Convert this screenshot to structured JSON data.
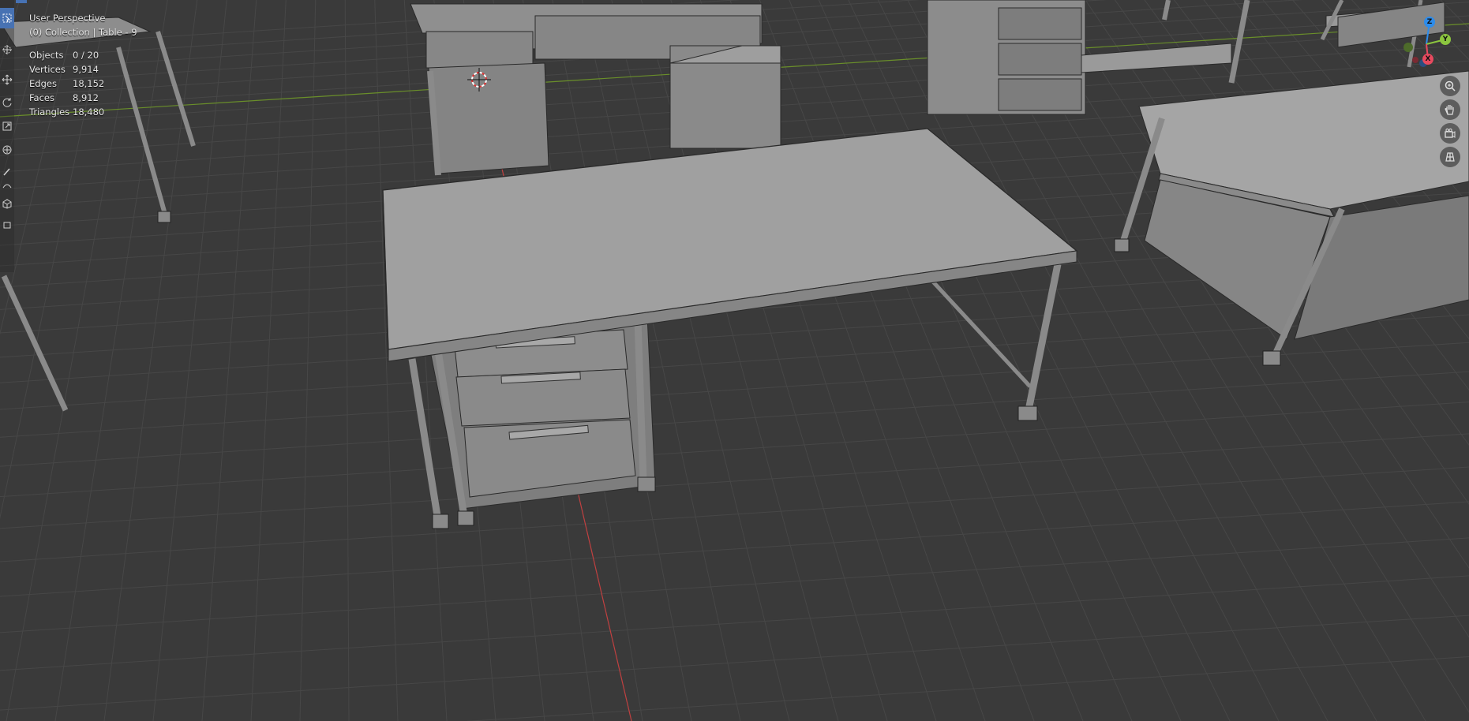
{
  "viewport": {
    "view_name": "User Perspective",
    "collection_line": "(0) Collection | Table - 9",
    "stats": [
      {
        "label": "Objects",
        "value": "0 / 20"
      },
      {
        "label": "Vertices",
        "value": "9,914"
      },
      {
        "label": "Edges",
        "value": "18,152"
      },
      {
        "label": "Faces",
        "value": "8,912"
      },
      {
        "label": "Triangles",
        "value": "18,480"
      }
    ]
  },
  "gizmo": {
    "z_label": "Z",
    "y_label": "Y",
    "x_label": "X",
    "colors": {
      "x": "#e84a5f",
      "y": "#8cc63f",
      "z": "#2d8ceb"
    }
  },
  "toolbar": {
    "tools": [
      "select-box-icon",
      "cursor-icon",
      "move-icon",
      "rotate-icon",
      "scale-icon",
      "transform-icon",
      "annotate-icon",
      "measure-icon",
      "add-cube-icon"
    ]
  },
  "nav_buttons": [
    "zoom-icon",
    "pan-hand-icon",
    "camera-icon",
    "grid-view-icon"
  ],
  "colors": {
    "floor": "#3a3a3a",
    "grid": "#444444",
    "x_axis": "#c04040",
    "y_axis": "#6a8f2a",
    "model": "#9a9a9a",
    "accent": "#4772b3"
  }
}
